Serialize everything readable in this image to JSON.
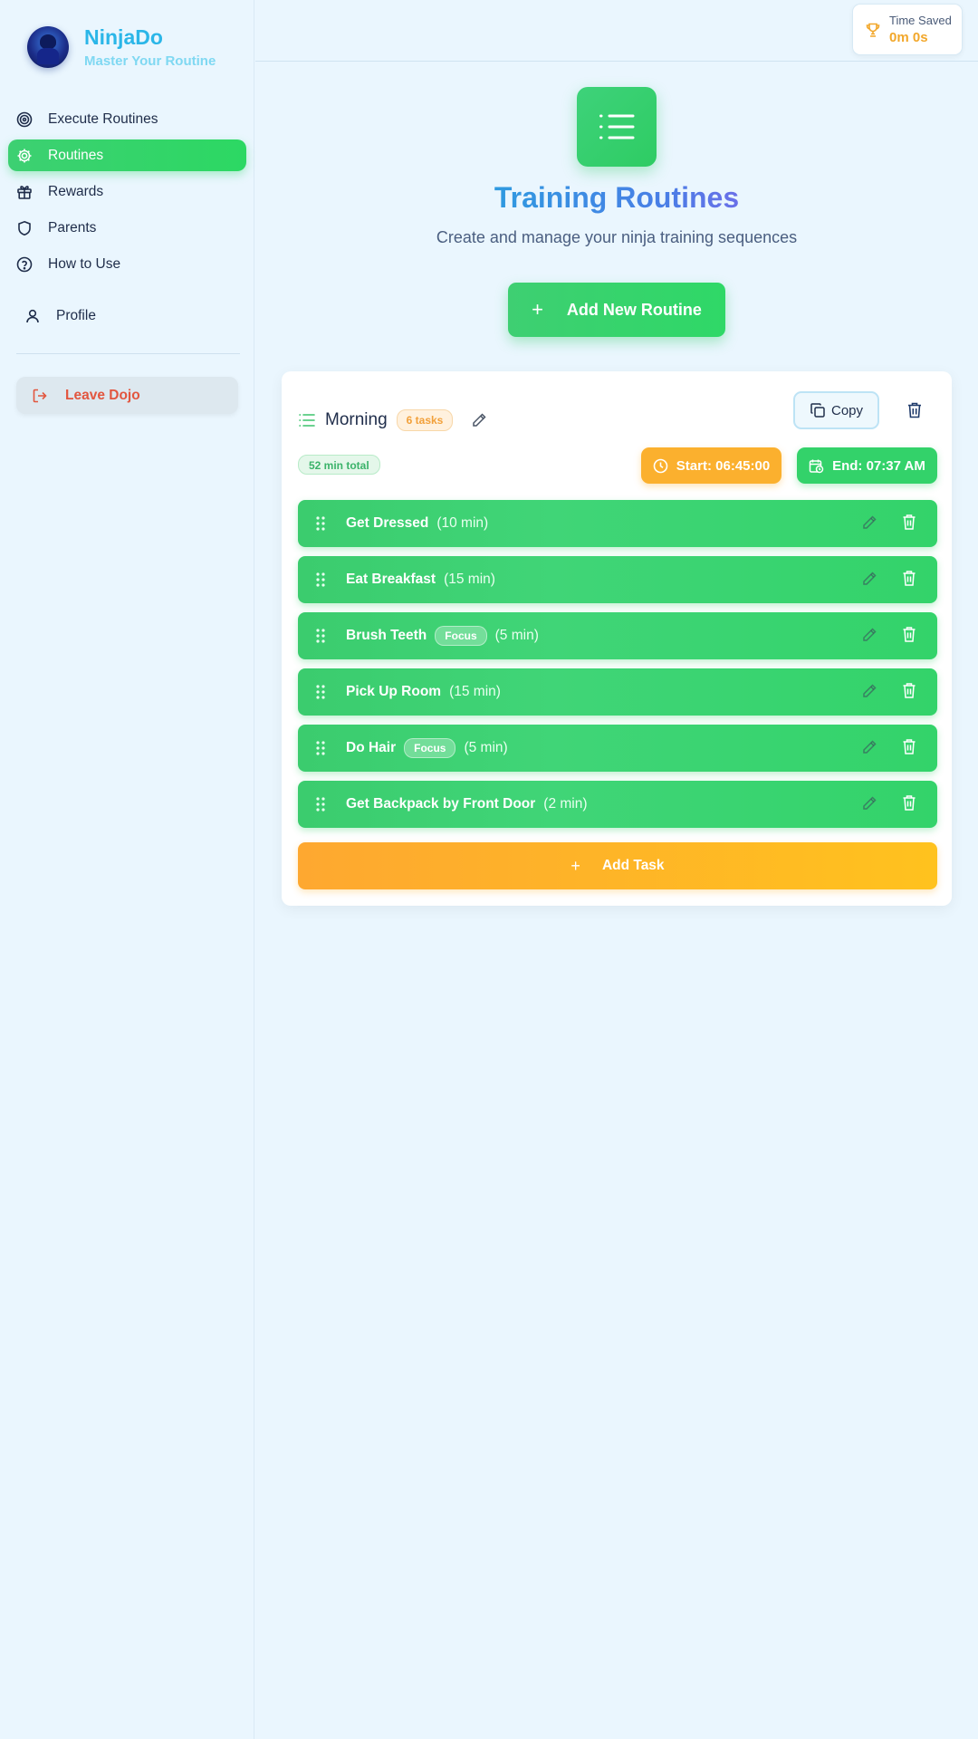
{
  "app": {
    "name": "NinjaDo",
    "tagline": "Master Your Routine"
  },
  "sidebar": {
    "items": [
      {
        "label": "Execute Routines",
        "icon": "target-icon",
        "active": false
      },
      {
        "label": "Routines",
        "icon": "gear-icon",
        "active": true
      },
      {
        "label": "Rewards",
        "icon": "gift-icon",
        "active": false
      },
      {
        "label": "Parents",
        "icon": "shield-icon",
        "active": false
      },
      {
        "label": "How to Use",
        "icon": "help-circle-icon",
        "active": false
      }
    ],
    "profile_label": "Profile",
    "leave_label": "Leave Dojo"
  },
  "header": {
    "time_saved_label": "Time Saved",
    "time_saved_value": "0m 0s"
  },
  "page": {
    "title": "Training Routines",
    "subtitle": "Create and manage your ninja training sequences",
    "add_routine_label": "Add New Routine"
  },
  "routine": {
    "name": "Morning",
    "tasks_badge": "6 tasks",
    "copy_label": "Copy",
    "total_badge": "52 min total",
    "start_label": "Start: 06:45:00",
    "end_label": "End: 07:37 AM",
    "tasks": [
      {
        "name": "Get Dressed",
        "focus": "",
        "duration": "(10 min)"
      },
      {
        "name": "Eat Breakfast",
        "focus": "",
        "duration": "(15 min)"
      },
      {
        "name": "Brush Teeth",
        "focus": "Focus",
        "duration": "(5 min)"
      },
      {
        "name": "Pick Up Room",
        "focus": "",
        "duration": "(15 min)"
      },
      {
        "name": "Do Hair",
        "focus": "Focus",
        "duration": "(5 min)"
      },
      {
        "name": "Get Backpack by Front Door",
        "focus": "",
        "duration": "(2 min)"
      }
    ],
    "add_task_label": "Add Task"
  },
  "colors": {
    "accent_green": "#2cd863",
    "accent_orange": "#fbb02e",
    "brand_blue": "#2bb6e8",
    "danger": "#e2563f",
    "background": "#eaf6fe"
  }
}
